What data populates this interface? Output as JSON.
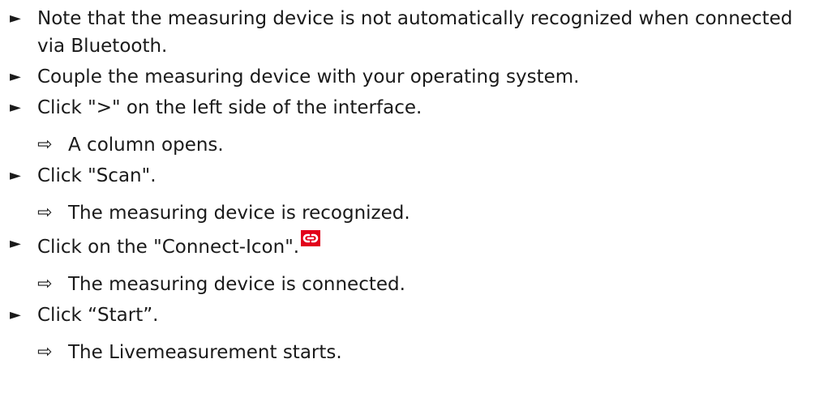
{
  "markers": {
    "step": "►",
    "result": "⇨"
  },
  "items": [
    {
      "kind": "step",
      "text": "Note that the measuring device is not automatically recognized when connected via Bluetooth."
    },
    {
      "kind": "step",
      "text": "Couple the measuring device with your operating system."
    },
    {
      "kind": "step",
      "text": "Click \">\" on the left side of the interface."
    },
    {
      "kind": "result",
      "text": "A column opens."
    },
    {
      "kind": "step",
      "text": "Click \"Scan\"."
    },
    {
      "kind": "result",
      "text": "The measuring device is recognized."
    },
    {
      "kind": "step",
      "text": "Click on the \"Connect-Icon\".",
      "icon": "link-icon"
    },
    {
      "kind": "result",
      "text": "The measuring device is connected."
    },
    {
      "kind": "step",
      "text": "Click “Start”."
    },
    {
      "kind": "result",
      "text": "The Livemeasurement starts."
    }
  ],
  "colors": {
    "text": "#1a1a1a",
    "icon_background": "#e2001a",
    "icon_foreground": "#ffffff"
  }
}
